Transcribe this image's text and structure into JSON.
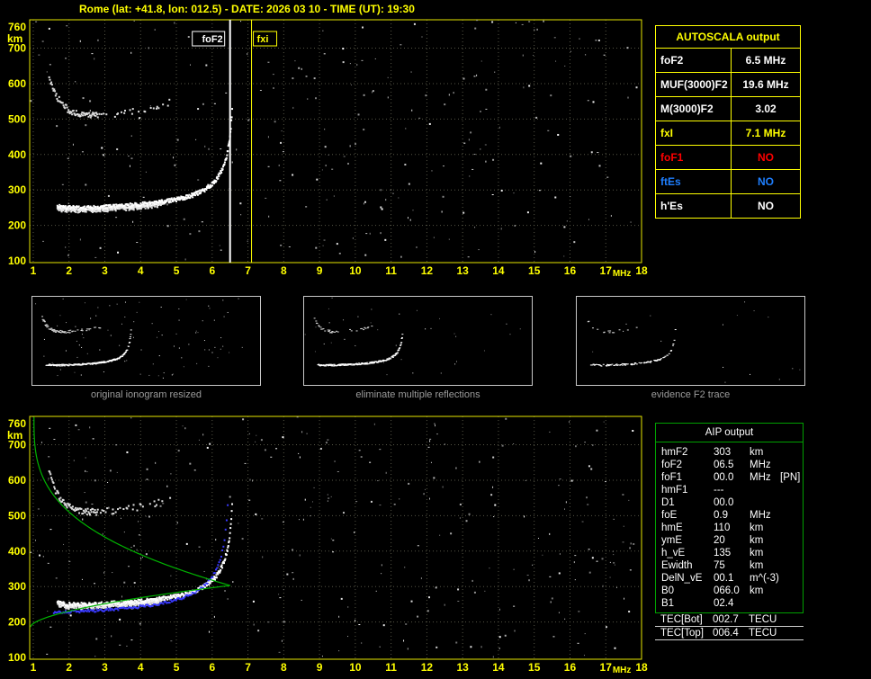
{
  "header": {
    "title": "Rome (lat: +41.8, lon: 012.5) - DATE: 2026 03 10 - TIME (UT): 19:30"
  },
  "chart": {
    "x_axis": {
      "unit": "MHz",
      "min": 0.9,
      "max": 18,
      "ticks": [
        1,
        2,
        3,
        4,
        5,
        6,
        7,
        8,
        9,
        10,
        11,
        12,
        13,
        14,
        15,
        16,
        17,
        18
      ]
    },
    "y_axis": {
      "unit": "km",
      "minh": 95,
      "maxh": 780,
      "ticks": [
        760,
        700,
        600,
        500,
        400,
        300,
        200,
        100
      ]
    },
    "markers": [
      {
        "label": "foF2",
        "freq": 6.5,
        "color": "#ffffff"
      },
      {
        "label": "fxi",
        "freq": 7.1,
        "color": "#ffff00"
      }
    ],
    "model": {
      "fc": 6.62,
      "hbase": 247,
      "k": 55,
      "blue": {
        "fc": 6.52,
        "hbase": 228,
        "k": 68
      },
      "profile": {
        "fmin": 1.02,
        "fmax": 6.5,
        "hm": 303,
        "htop": 778,
        "hbot": 186
      }
    }
  },
  "chart_data": [
    {
      "type": "scatter",
      "title": "scaled ionogram with foF2 / fxI markers",
      "xlabel": "MHz",
      "ylabel": "km",
      "xlim": [
        1,
        18
      ],
      "ylim": [
        100,
        760
      ],
      "annotations": [
        {
          "label": "foF2",
          "x": 6.5
        },
        {
          "label": "fxi",
          "x": 7.1
        }
      ],
      "series": [
        {
          "name": "F2 trace (virtual height)",
          "x": [
            2,
            3,
            4,
            5,
            5.5,
            6,
            6.3,
            6.5,
            6.55
          ],
          "y": [
            252,
            258,
            268,
            283,
            296,
            325,
            372,
            436,
            470
          ]
        },
        {
          "name": "second hop echo",
          "x": [
            1.5,
            1.8,
            2.1,
            2.5,
            3,
            3.5,
            4,
            4.5
          ],
          "y": [
            640,
            560,
            530,
            512,
            505,
            510,
            522,
            545
          ]
        }
      ]
    },
    {
      "type": "scatter",
      "title": "ionogram with AIP inversion profile",
      "xlabel": "MHz",
      "ylabel": "km",
      "xlim": [
        1,
        18
      ],
      "ylim": [
        100,
        760
      ],
      "series": [
        {
          "name": "F2 trace (virtual height)",
          "x": [
            2,
            3,
            4,
            5,
            5.5,
            6,
            6.3,
            6.5,
            6.55
          ],
          "y": [
            252,
            258,
            268,
            283,
            296,
            325,
            372,
            436,
            470
          ]
        },
        {
          "name": "fitted trace (blue)",
          "x": [
            2,
            3,
            4,
            5,
            6,
            6.3,
            6.45
          ],
          "y": [
            231,
            238,
            250,
            268,
            334,
            424,
            520
          ]
        },
        {
          "name": "electron density profile (green)",
          "x": [
            1.02,
            1.03,
            1.26,
            2.03,
            3.7,
            4.97,
            5.91,
            6.5,
            4.76,
            2.92,
            1.6,
            1.07,
            0.92
          ],
          "y": [
            760,
            700,
            600,
            500,
            400,
            350,
            320,
            303,
            280,
            250,
            220,
            200,
            186
          ]
        }
      ]
    }
  ],
  "autoscala": {
    "title": "AUTOSCALA output",
    "rows": [
      {
        "label": "foF2",
        "value": "6.5 MHz",
        "color": "#ffffff"
      },
      {
        "label": "MUF(3000)F2",
        "value": "19.6 MHz",
        "color": "#ffffff"
      },
      {
        "label": "M(3000)F2",
        "value": "3.02",
        "color": "#ffffff"
      },
      {
        "label": "fxI",
        "value": "7.1 MHz",
        "color": "#ffff00"
      },
      {
        "label": "foF1",
        "value": "NO",
        "color": "#ff0000"
      },
      {
        "label": "ftEs",
        "value": "NO",
        "color": "#1f7fff"
      },
      {
        "label": "h'Es",
        "value": "NO",
        "color": "#ffffff"
      }
    ]
  },
  "thumbnails": [
    {
      "caption": "original ionogram resized"
    },
    {
      "caption": "eliminate multiple reflections"
    },
    {
      "caption": "evidence F2 trace"
    }
  ],
  "aip": {
    "title": "AIP output",
    "rows": [
      {
        "label": "hmF2",
        "value": "303",
        "unit": "km",
        "extra": ""
      },
      {
        "label": "foF2",
        "value": "06.5",
        "unit": "MHz",
        "extra": ""
      },
      {
        "label": "foF1",
        "value": "00.0",
        "unit": "MHz",
        "extra": "[PN]"
      },
      {
        "label": "hmF1",
        "value": "---",
        "unit": "",
        "extra": ""
      },
      {
        "label": "D1",
        "value": "00.0",
        "unit": "",
        "extra": ""
      },
      {
        "label": "foE",
        "value": "0.9",
        "unit": "MHz",
        "extra": ""
      },
      {
        "label": "hmE",
        "value": "110",
        "unit": "km",
        "extra": ""
      },
      {
        "label": "ymE",
        "value": "20",
        "unit": "km",
        "extra": ""
      },
      {
        "label": "h_vE",
        "value": "135",
        "unit": "km",
        "extra": ""
      },
      {
        "label": "Ewidth",
        "value": "75",
        "unit": "km",
        "extra": ""
      },
      {
        "label": "DelN_vE",
        "value": "00.1",
        "unit": "m^(-3)",
        "extra": ""
      },
      {
        "label": "B0",
        "value": "066.0",
        "unit": "km",
        "extra": ""
      },
      {
        "label": "B1",
        "value": "02.4",
        "unit": "",
        "extra": ""
      }
    ],
    "tec": [
      {
        "label": "TEC[Bot]",
        "value": "002.7",
        "unit": "TECU"
      },
      {
        "label": "TEC[Top]",
        "value": "006.4",
        "unit": "TECU"
      }
    ]
  }
}
